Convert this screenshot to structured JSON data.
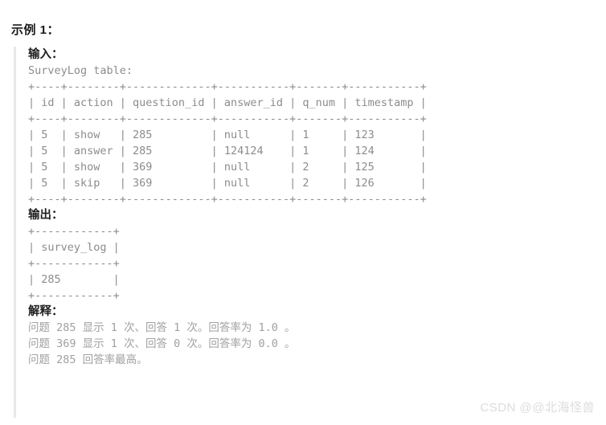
{
  "heading": "示例 1：",
  "input_section": {
    "label": "输入：",
    "caption": "SurveyLog table:",
    "table": {
      "border": "+----+--------+-------------+-----------+-------+-----------+",
      "header": "| id | action | question_id | answer_id | q_num | timestamp |",
      "rows": [
        "| 5  | show   | 285         | null      | 1     | 123       |",
        "| 5  | answer | 285         | 124124    | 1     | 124       |",
        "| 5  | show   | 369         | null      | 2     | 125       |",
        "| 5  | skip   | 369         | null      | 2     | 126       |"
      ],
      "columns": [
        "id",
        "action",
        "question_id",
        "answer_id",
        "q_num",
        "timestamp"
      ],
      "data": [
        {
          "id": "5",
          "action": "show",
          "question_id": "285",
          "answer_id": "null",
          "q_num": "1",
          "timestamp": "123"
        },
        {
          "id": "5",
          "action": "answer",
          "question_id": "285",
          "answer_id": "124124",
          "q_num": "1",
          "timestamp": "124"
        },
        {
          "id": "5",
          "action": "show",
          "question_id": "369",
          "answer_id": "null",
          "q_num": "2",
          "timestamp": "125"
        },
        {
          "id": "5",
          "action": "skip",
          "question_id": "369",
          "answer_id": "null",
          "q_num": "2",
          "timestamp": "126"
        }
      ]
    }
  },
  "output_section": {
    "label": "输出：",
    "table": {
      "border": "+------------+",
      "header": "| survey_log |",
      "rows": [
        "| 285        |"
      ],
      "columns": [
        "survey_log"
      ],
      "data": [
        {
          "survey_log": "285"
        }
      ]
    }
  },
  "explanation_section": {
    "label": "解释：",
    "lines": [
      "问题 285 显示 1 次、回答 1 次。回答率为 1.0 。",
      "问题 369 显示 1 次、回答 0 次。回答率为 0.0 。",
      "问题 285 回答率最高。"
    ]
  },
  "watermark": "CSDN @@北海怪兽",
  "colors": {
    "text_dark": "#1a1a1a",
    "code_gray": "#8c8c8c",
    "note_gray": "#a0a0a0",
    "bar_gray": "#e8e8e8",
    "watermark_gray": "#dcdcdc",
    "background": "#ffffff"
  }
}
